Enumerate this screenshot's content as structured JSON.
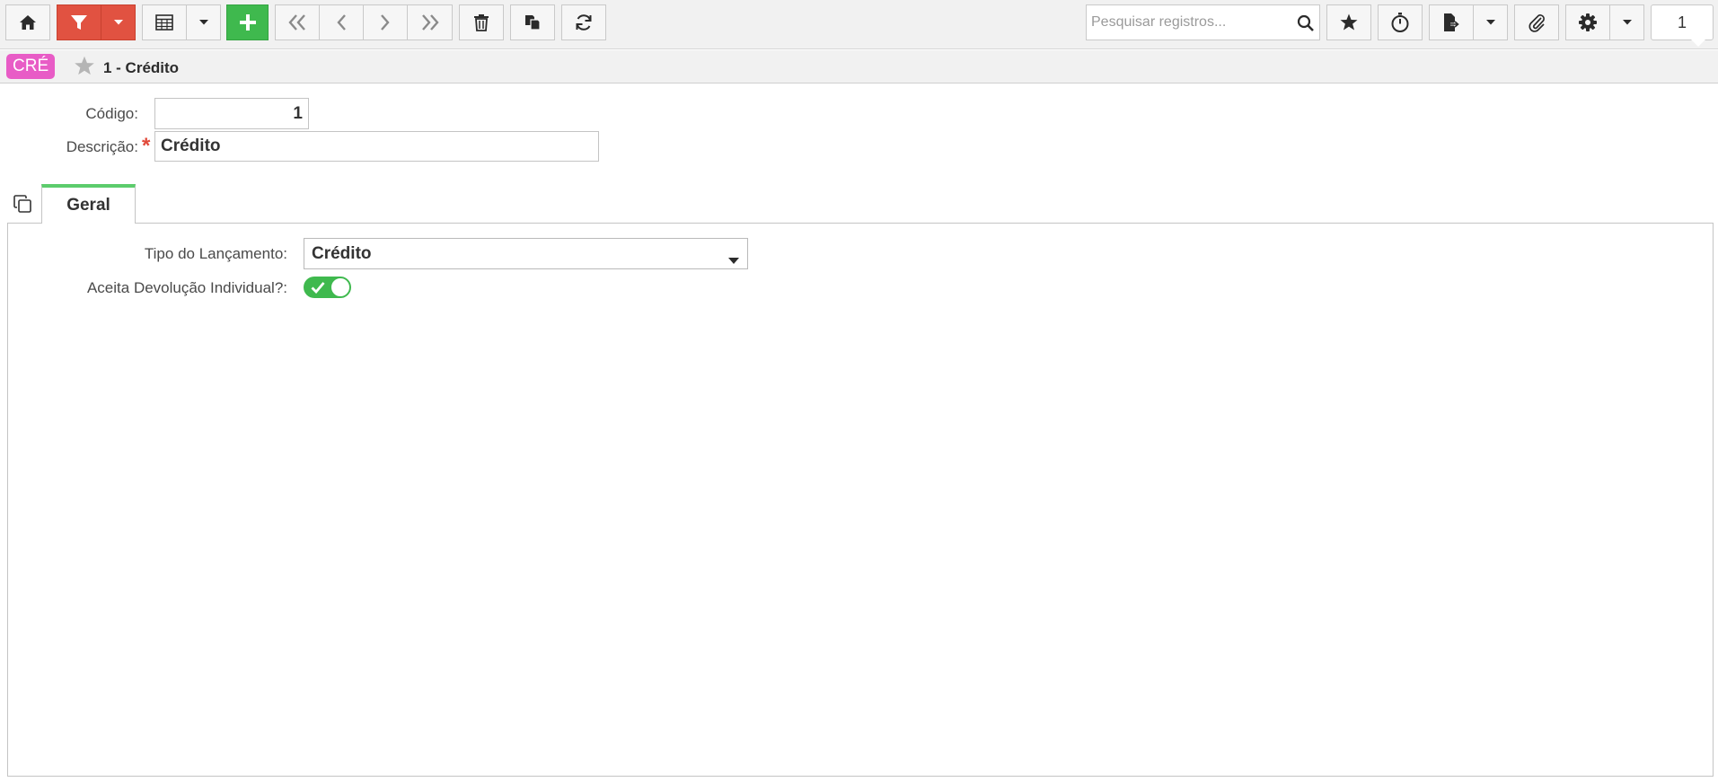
{
  "toolbar": {
    "search_placeholder": "Pesquisar registros...",
    "page_number": "1",
    "buttons": [
      "home-icon",
      "filter-icon",
      "grid-icon",
      "plus-icon",
      "first-icon",
      "prev-icon",
      "next-icon",
      "last-icon",
      "trash-icon",
      "copy-icon",
      "refresh-icon",
      "star-icon",
      "timer-icon",
      "export-icon",
      "attach-icon",
      "gear-icon"
    ]
  },
  "header": {
    "badge": "CRÉ",
    "title": "1 - Crédito"
  },
  "form": {
    "codigo_label": "Código:",
    "codigo_value": "1",
    "descricao_label": "Descrição:",
    "descricao_value": "Crédito",
    "required_mark": "*"
  },
  "tabs": [
    {
      "label": "Geral",
      "active": true
    }
  ],
  "geral": {
    "tipo_label": "Tipo do Lançamento:",
    "tipo_value": "Crédito",
    "devolucao_label": "Aceita Devolução Individual?:",
    "devolucao_on": true
  },
  "colors": {
    "accent_green": "#3fb94e",
    "filter_red": "#e15241",
    "badge_pink": "#e85cc6",
    "required_red": "#e14a3b"
  }
}
